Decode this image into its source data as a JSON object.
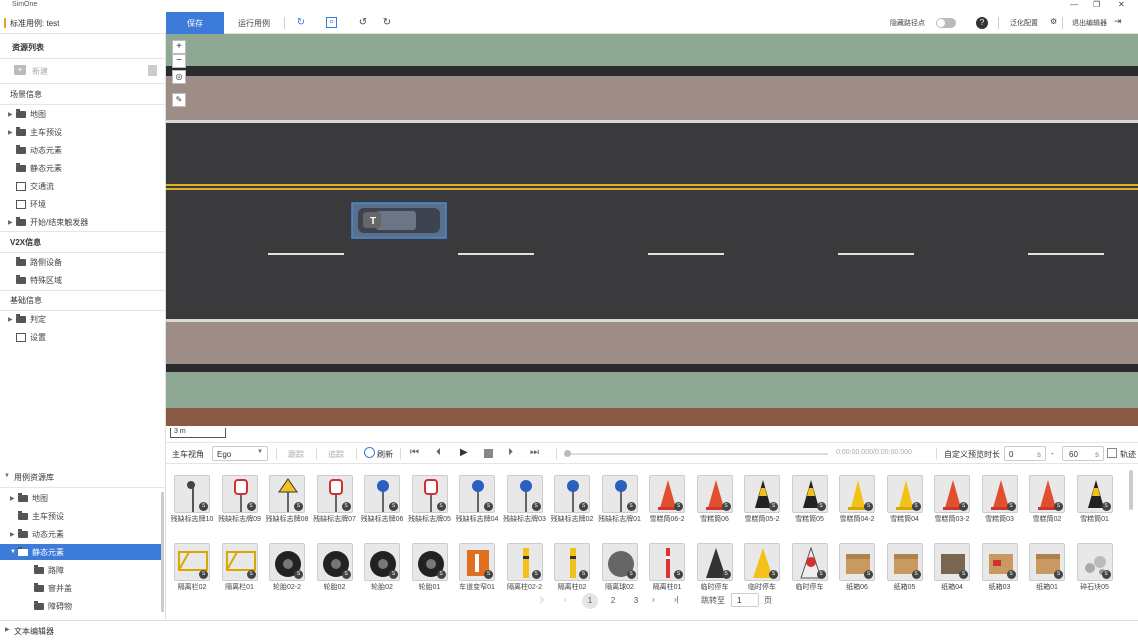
{
  "app": {
    "title": "SimOne"
  },
  "case": {
    "label": "标准用例: test"
  },
  "toolbar": {
    "save": "保存",
    "run": "运行用例",
    "hide_waypoint": "隐藏路径点",
    "help": "?",
    "generalize": "泛化配置",
    "exit": "退出编辑器"
  },
  "left_panel": {
    "resource_list": "资源列表",
    "new": "新建",
    "add_section": "场景信息",
    "add_items": [
      {
        "label": "地图",
        "icon": "folder-icon",
        "caret": true
      },
      {
        "label": "主车预设",
        "icon": "folder-icon",
        "caret": true
      },
      {
        "label": "动态元素",
        "icon": "folder-icon",
        "caret": false
      },
      {
        "label": "静态元素",
        "icon": "folder-icon",
        "caret": false
      },
      {
        "label": "交通流",
        "icon": "traffic-icon",
        "caret": false
      },
      {
        "label": "环境",
        "icon": "weather-icon",
        "caret": false
      },
      {
        "label": "开始/结束触发器",
        "icon": "folder-icon",
        "caret": true
      }
    ],
    "v2x_section": "V2X信息",
    "v2x_items": [
      {
        "label": "路侧设备",
        "icon": "folder-icon"
      },
      {
        "label": "特殊区域",
        "icon": "folder-icon"
      }
    ],
    "basic_section": "基础信息",
    "basic_items": [
      {
        "label": "判定",
        "icon": "folder-icon",
        "caret": true
      },
      {
        "label": "设置",
        "icon": "settings-icon",
        "caret": false
      }
    ]
  },
  "scene": {
    "vehicle_label": "T",
    "scale": "3 m",
    "zoom_in": "+",
    "zoom_out": "−"
  },
  "controls": {
    "main_view": "主车视角",
    "ego_select": "Ego",
    "follow": "跟踪",
    "track": "追踪",
    "refresh": "刷新",
    "time": "0:00:00.000/0:00:00.000",
    "custom_preview": "自定义预览时长",
    "start": "0",
    "start_unit": "s",
    "dash": "-",
    "end": "60",
    "end_unit": "s",
    "trajectory": "轨迹"
  },
  "library": {
    "title": "用例资源库",
    "tree": [
      {
        "label": "地图",
        "caret": "right",
        "selected": false,
        "indent": 0
      },
      {
        "label": "主车预设",
        "caret": "",
        "selected": false,
        "indent": 0
      },
      {
        "label": "动态元素",
        "caret": "right",
        "selected": false,
        "indent": 0
      },
      {
        "label": "静态元素",
        "caret": "down",
        "selected": true,
        "indent": 0
      },
      {
        "label": "路障",
        "caret": "",
        "selected": false,
        "indent": 1
      },
      {
        "label": "窨井盖",
        "caret": "",
        "selected": false,
        "indent": 1
      },
      {
        "label": "障碍物",
        "caret": "",
        "selected": false,
        "indent": 1
      }
    ],
    "row1": [
      {
        "label": "残缺标志牌10",
        "kind": "sign-gray"
      },
      {
        "label": "残缺标志牌09",
        "kind": "sign-red"
      },
      {
        "label": "残缺标志牌08",
        "kind": "sign-yellow"
      },
      {
        "label": "残缺标志牌07",
        "kind": "sign-red"
      },
      {
        "label": "残缺标志牌06",
        "kind": "sign-blue"
      },
      {
        "label": "残缺标志牌05",
        "kind": "sign-red"
      },
      {
        "label": "残缺标志牌04",
        "kind": "sign-blue"
      },
      {
        "label": "残缺标志牌03",
        "kind": "sign-blue"
      },
      {
        "label": "残缺标志牌02",
        "kind": "sign-blue"
      },
      {
        "label": "残缺标志牌01",
        "kind": "sign-blue"
      },
      {
        "label": "雪糕筒06-2",
        "kind": "cone-red"
      },
      {
        "label": "雪糕筒06",
        "kind": "cone-red"
      },
      {
        "label": "雪糕筒05-2",
        "kind": "cone-black"
      },
      {
        "label": "雪糕筒05",
        "kind": "cone-black"
      },
      {
        "label": "雪糕筒04-2",
        "kind": "cone-yellow"
      },
      {
        "label": "雪糕筒04",
        "kind": "cone-yellow"
      },
      {
        "label": "雪糕筒03-2",
        "kind": "cone-red"
      },
      {
        "label": "雪糕筒03",
        "kind": "cone-red"
      },
      {
        "label": "雪糕筒02",
        "kind": "cone-red"
      },
      {
        "label": "雪糕筒01",
        "kind": "cone-black"
      }
    ],
    "row2": [
      {
        "label": "隔离栏02",
        "kind": "barrier"
      },
      {
        "label": "隔离栏01",
        "kind": "barrier"
      },
      {
        "label": "轮胎02-2",
        "kind": "tire"
      },
      {
        "label": "轮胎02",
        "kind": "tire"
      },
      {
        "label": "轮胎02",
        "kind": "tire"
      },
      {
        "label": "轮胎01",
        "kind": "tire"
      },
      {
        "label": "车道变窄01",
        "kind": "sign-orange"
      },
      {
        "label": "隔离柱02-2",
        "kind": "post-yellow"
      },
      {
        "label": "隔离柱02",
        "kind": "post-yellow"
      },
      {
        "label": "隔离球02",
        "kind": "ball"
      },
      {
        "label": "隔离柱01",
        "kind": "post-red"
      },
      {
        "label": "临时停车",
        "kind": "aframe-black"
      },
      {
        "label": "临时停车",
        "kind": "aframe-yellow"
      },
      {
        "label": "临时停车",
        "kind": "aframe-white"
      },
      {
        "label": "纸箱06",
        "kind": "box"
      },
      {
        "label": "纸箱05",
        "kind": "box"
      },
      {
        "label": "纸箱04",
        "kind": "box-dark"
      },
      {
        "label": "纸箱03",
        "kind": "box-red"
      },
      {
        "label": "纸箱01",
        "kind": "box"
      },
      {
        "label": "碎石块05",
        "kind": "rocks"
      }
    ],
    "pagination": {
      "pages": [
        "1",
        "2",
        "3"
      ],
      "current": "1",
      "goto": "跳转至",
      "page_value": "1",
      "page_unit": "页"
    }
  },
  "footer": {
    "text_editor": "文本编辑器"
  },
  "colors": {
    "accent": "#3d7bd9",
    "road": "#3a3a3c",
    "sidewalk": "#9e8c86",
    "grass": "#8fa894"
  }
}
